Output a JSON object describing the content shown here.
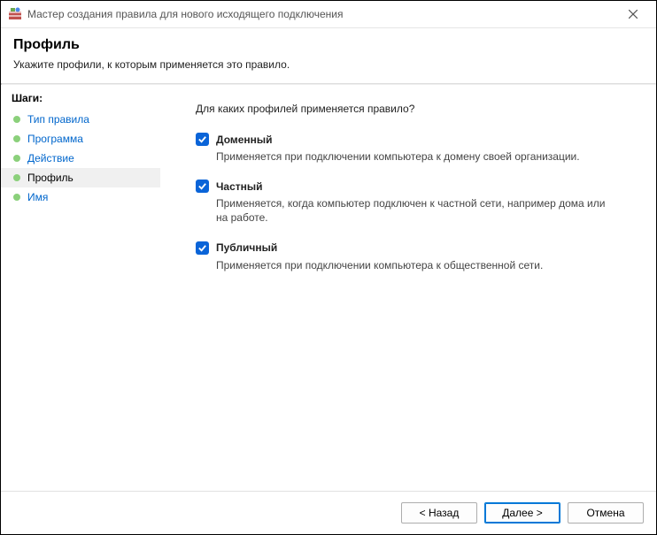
{
  "window": {
    "title": "Мастер создания правила для нового исходящего подключения"
  },
  "header": {
    "title": "Профиль",
    "subtitle": "Укажите профили, к которым применяется это правило."
  },
  "sidebar": {
    "title": "Шаги:",
    "steps": [
      {
        "label": "Тип правила"
      },
      {
        "label": "Программа"
      },
      {
        "label": "Действие"
      },
      {
        "label": "Профиль"
      },
      {
        "label": "Имя"
      }
    ]
  },
  "content": {
    "question": "Для каких профилей применяется правило?",
    "options": [
      {
        "label": "Доменный",
        "desc": "Применяется при подключении компьютера к домену своей организации.",
        "checked": true
      },
      {
        "label": "Частный",
        "desc": "Применяется, когда компьютер подключен к частной сети, например дома или на работе.",
        "checked": true
      },
      {
        "label": "Публичный",
        "desc": "Применяется при подключении компьютера к общественной сети.",
        "checked": true
      }
    ]
  },
  "footer": {
    "back": "< Назад",
    "next": "Далее >",
    "cancel": "Отмена"
  }
}
